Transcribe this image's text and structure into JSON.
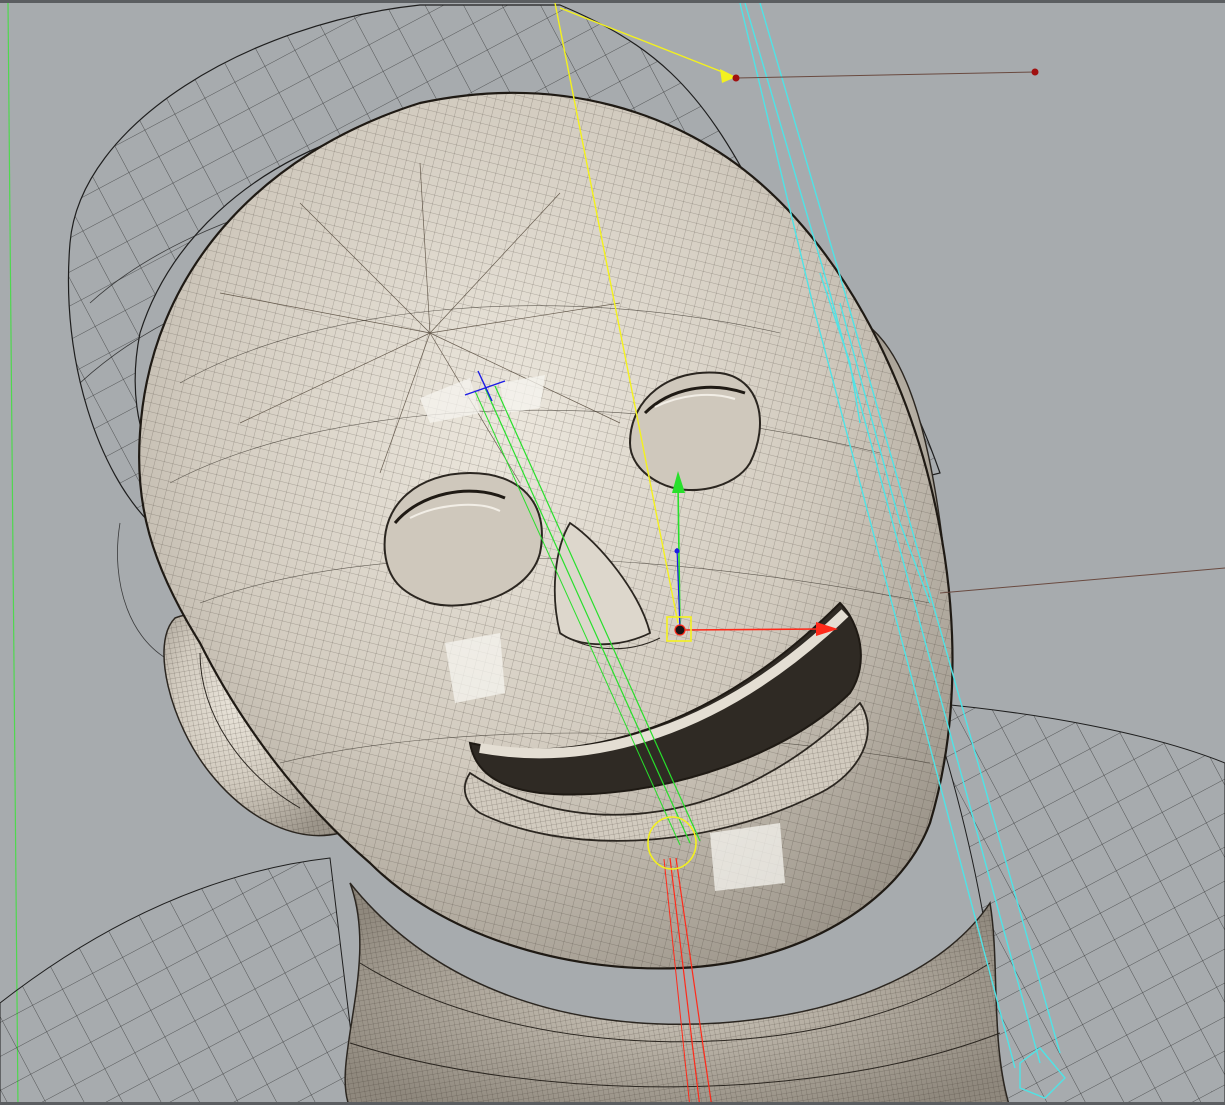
{
  "viewport": {
    "background_color": "#a7abae",
    "frame_color": "#5b5e61"
  },
  "mesh": {
    "surface_color": "#d3cdc2",
    "wire_color": "#2b2620",
    "cage_color": "#1e1e1e"
  },
  "gizmo": {
    "x_axis_color": "#ff2a1a",
    "y_axis_color": "#27e02b",
    "z_axis_color": "#1c1ce6",
    "selection_color": "#f3f11e"
  },
  "rig": {
    "bone_color": "#4fe3e6",
    "light_line_color": "#f3f11e",
    "light_point_color": "#a01010",
    "world_axis_color": "#4fd84f"
  }
}
